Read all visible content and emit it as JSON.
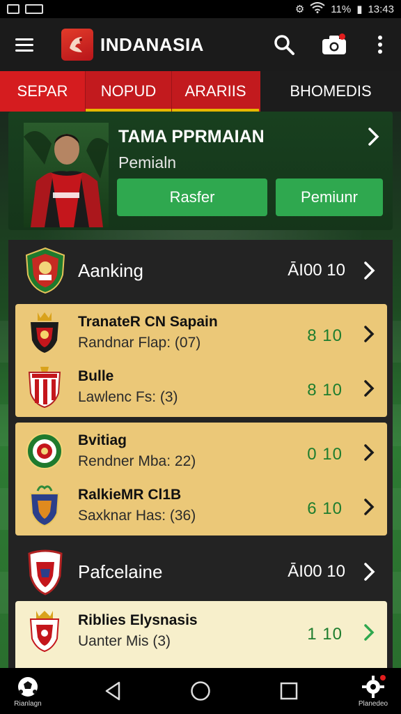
{
  "status_bar": {
    "battery": "11%",
    "time": "13:43"
  },
  "app_bar": {
    "title": "INDANASIA"
  },
  "tabs": [
    {
      "label": "SEPAR"
    },
    {
      "label": "NOPUD"
    },
    {
      "label": "ARARIIS"
    },
    {
      "label": "BHOMEDIS"
    }
  ],
  "player_card": {
    "title": "TAMA PPRMAIAN",
    "subtitle": "Pemialn",
    "primary_button": "Rasfer",
    "secondary_button": "Pemiunr"
  },
  "sections": [
    {
      "title": "Aanking",
      "score": "ĀI00 10",
      "groups": [
        {
          "style": "gold",
          "rows": [
            {
              "name": "TranateR CN Sapain",
              "sub": "Randnar Flap: (07)",
              "score": "8  10"
            },
            {
              "name": "Bulle",
              "sub": "Lawlenc Fs: (3)",
              "score": "8  10"
            }
          ]
        },
        {
          "style": "gold",
          "rows": [
            {
              "name": "Bvitiag",
              "sub": "Rendner Mba: 22)",
              "score": "0  10"
            },
            {
              "name": "RalkieMR Cl1B",
              "sub": "Saxknar Has: (36)",
              "score": "6  10"
            }
          ]
        }
      ]
    },
    {
      "title": "Pafcelaine",
      "score": "ĀI00 10",
      "groups": [
        {
          "style": "cream",
          "rows": [
            {
              "name": "Riblies Elysnasis",
              "sub": "Uanter Mis (3)",
              "score": "1  10"
            }
          ]
        }
      ]
    }
  ],
  "bottom_nav": {
    "left_label": "Rianlagn",
    "right_label": "Planedeo"
  },
  "colors": {
    "accent_red": "#d51c1f",
    "accent_green": "#2fa84f",
    "gold_card": "#ebc878",
    "cream_card": "#f7efcb",
    "dark_panel": "#232323"
  }
}
